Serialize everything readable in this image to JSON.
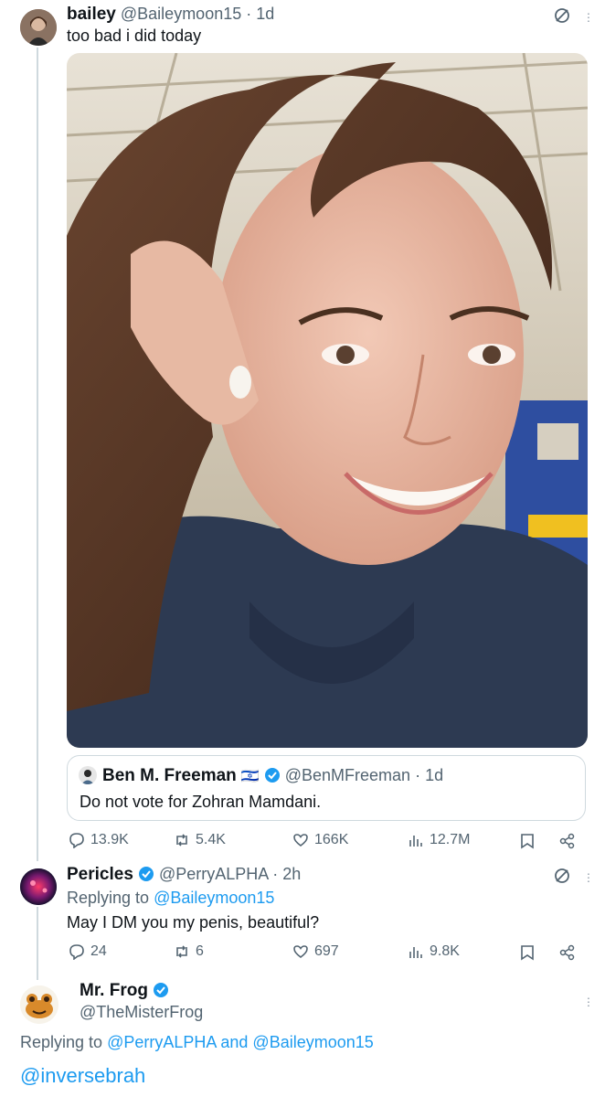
{
  "tweet1": {
    "name": "bailey",
    "handle": "@Baileymoon15",
    "time": "· 1d",
    "text": "too bad i did today"
  },
  "quote": {
    "name": "Ben M. Freeman",
    "flag": "🇮🇱",
    "handle": "@BenMFreeman",
    "time": "· 1d",
    "text": "Do not vote for Zohran Mamdani."
  },
  "tweet1_actions": {
    "replies": "13.9K",
    "reposts": "5.4K",
    "likes": "166K",
    "views": "12.7M"
  },
  "tweet2": {
    "name": "Pericles",
    "handle": "@PerryALPHA",
    "time": "· 2h",
    "replying_prefix": "Replying to",
    "replying_to": "@Baileymoon15",
    "text": "May I DM you my penis, beautiful?"
  },
  "tweet2_actions": {
    "replies": "24",
    "reposts": "6",
    "likes": "697",
    "views": "9.8K"
  },
  "tweet3": {
    "name": "Mr. Frog",
    "handle": "@TheMisterFrog",
    "replying_prefix": "Replying to",
    "replying_to": "@PerryALPHA and @Baileymoon15",
    "text": "@inversebrah"
  },
  "colors": {
    "accent": "#1d9bf0",
    "muted": "#536471",
    "border": "#cfd9de"
  }
}
